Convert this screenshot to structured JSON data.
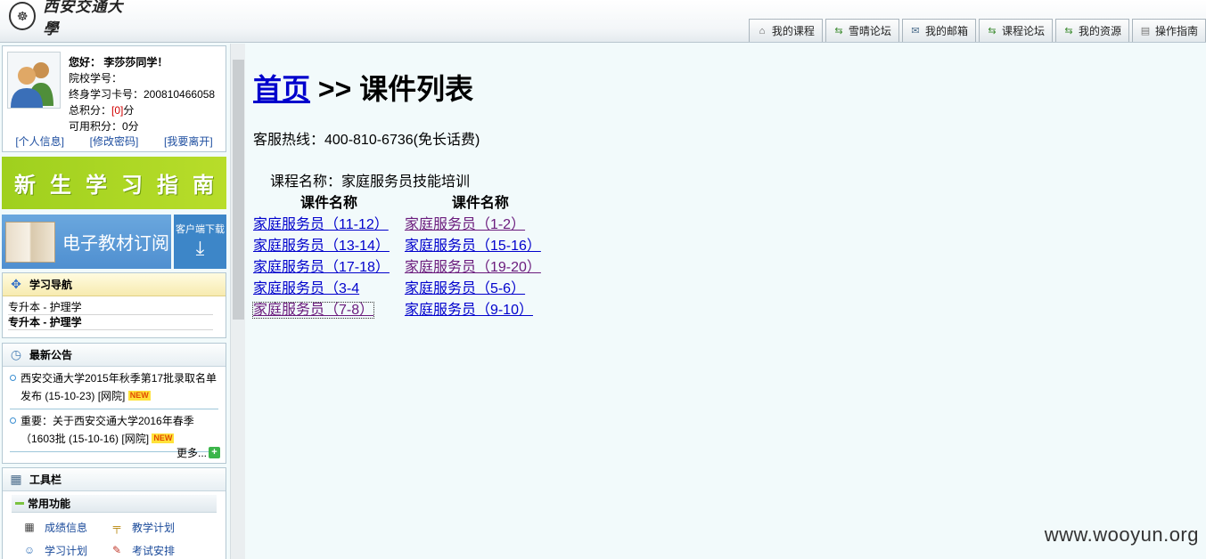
{
  "header": {
    "logo_text": "西安交通大學",
    "nav_tabs": [
      {
        "label": "我的课程",
        "icon": "home-icon"
      },
      {
        "label": "雪晴论坛",
        "icon": "forum-icon"
      },
      {
        "label": "我的邮箱",
        "icon": "mail-icon"
      },
      {
        "label": "课程论坛",
        "icon": "forum-icon"
      },
      {
        "label": "我的资源",
        "icon": "resource-icon"
      },
      {
        "label": "操作指南",
        "icon": "guide-icon"
      }
    ]
  },
  "user": {
    "greeting": "您好： 李莎莎同学！",
    "school_id_label": "院校学号：",
    "card_label": "终身学习卡号：200810466058",
    "total_points_label": "总积分：",
    "total_points_value": "[0]",
    "points_unit": "分",
    "available_points": "可用积分：0分",
    "links": [
      "[个人信息]",
      "[修改密码]",
      "[我要离开]"
    ]
  },
  "banners": {
    "guide": [
      "新",
      "生",
      "学",
      "习",
      "指",
      "南"
    ],
    "ebook": "电子教材订阅",
    "client_download": "客户端下载"
  },
  "study_nav": {
    "title": "学习导航",
    "items": [
      "专升本 - 护理学",
      "专升本 - 护理学"
    ]
  },
  "notices": {
    "title": "最新公告",
    "items": [
      {
        "text": "西安交通大学2015年秋季第17批录取名单发布 (15-10-23) [网院]",
        "badge": "NEW"
      },
      {
        "text": "重要：关于西安交通大学2016年春季（1603批 (15-10-16) [网院]",
        "badge": "NEW"
      }
    ],
    "more": "更多..."
  },
  "toolbar": {
    "title": "工具栏",
    "section": "常用功能",
    "items": [
      {
        "label": "成绩信息",
        "icon": "grades-icon"
      },
      {
        "label": "教学计划",
        "icon": "plan-icon"
      },
      {
        "label": "学习计划",
        "icon": "study-plan-icon"
      },
      {
        "label": "考试安排",
        "icon": "exam-icon"
      }
    ]
  },
  "main": {
    "home_link": "首页",
    "separator": " >> ",
    "page_title": "课件列表",
    "hotline": "客服热线：400-810-6736(免长话费)",
    "course_name": "课程名称：家庭服务员技能培训",
    "table_headers": [
      "课件名称",
      "课件名称"
    ],
    "rows": [
      [
        "家庭服务员（11-12）",
        "家庭服务员（1-2）"
      ],
      [
        "家庭服务员（13-14）",
        "家庭服务员（15-16）"
      ],
      [
        "家庭服务员（17-18）",
        "家庭服务员（19-20）"
      ],
      [
        "家庭服务员（3-4",
        "家庭服务员（5-6）"
      ],
      [
        "家庭服务员（7-8）",
        "家庭服务员（9-10）"
      ]
    ]
  },
  "watermark": "www.wooyun.org",
  "colors": {
    "link": "#0000cc",
    "visited_link": "#6a1a7c",
    "guide_banner": "#a6d322",
    "ebook_banner": "#5b9bd8"
  }
}
